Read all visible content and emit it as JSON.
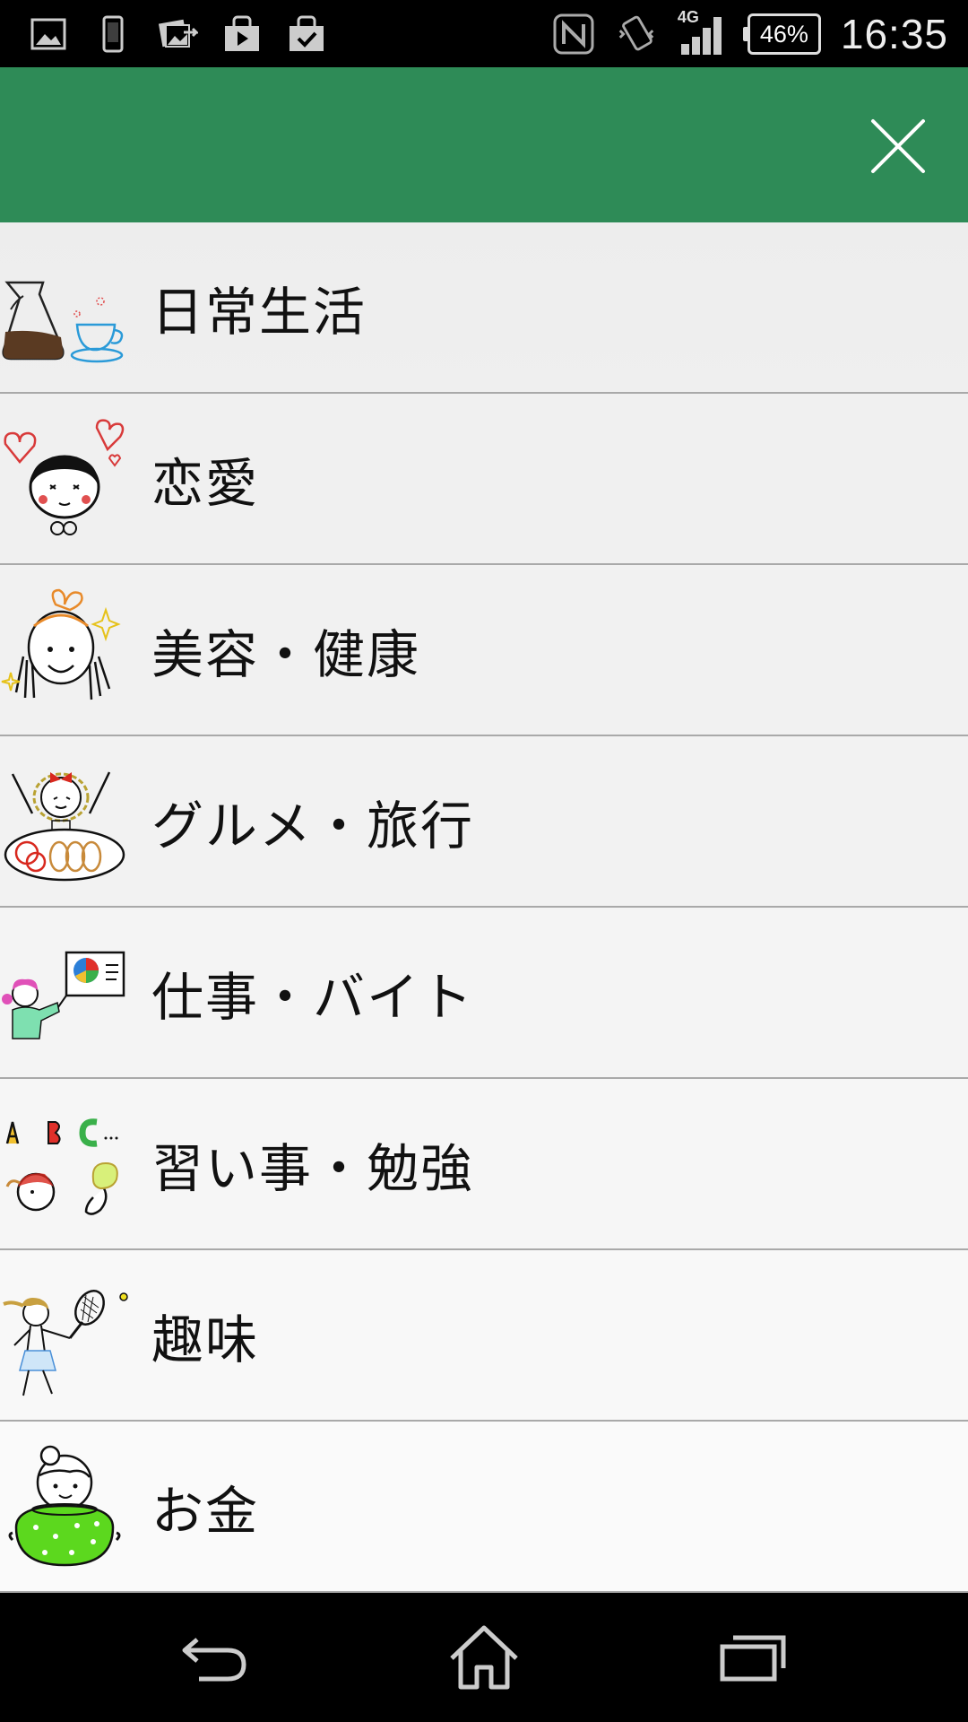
{
  "status_bar": {
    "left_icons": [
      "image-icon",
      "phone-icon",
      "photos-share-icon",
      "play-store-icon",
      "shopping-bag-check-icon"
    ],
    "right_icons": [
      "nfc-icon",
      "vibrate-icon",
      "signal-4g-icon"
    ],
    "network": "4G",
    "battery": "46%",
    "time": "16:35"
  },
  "app_bar": {
    "color": "#2e8b57",
    "close_icon": "close-icon"
  },
  "categories": [
    {
      "label": "日常生活",
      "icon": "coffee-illustration"
    },
    {
      "label": "恋愛",
      "icon": "love-illustration"
    },
    {
      "label": "美容・健康",
      "icon": "beauty-illustration"
    },
    {
      "label": "グルメ・旅行",
      "icon": "gourmet-illustration"
    },
    {
      "label": "仕事・バイト",
      "icon": "work-illustration"
    },
    {
      "label": "習い事・勉強",
      "icon": "study-illustration"
    },
    {
      "label": "趣味",
      "icon": "hobby-illustration"
    },
    {
      "label": "お金",
      "icon": "money-illustration"
    }
  ],
  "nav_bar": {
    "back": "back-icon",
    "home": "home-icon",
    "recents": "recents-icon"
  }
}
